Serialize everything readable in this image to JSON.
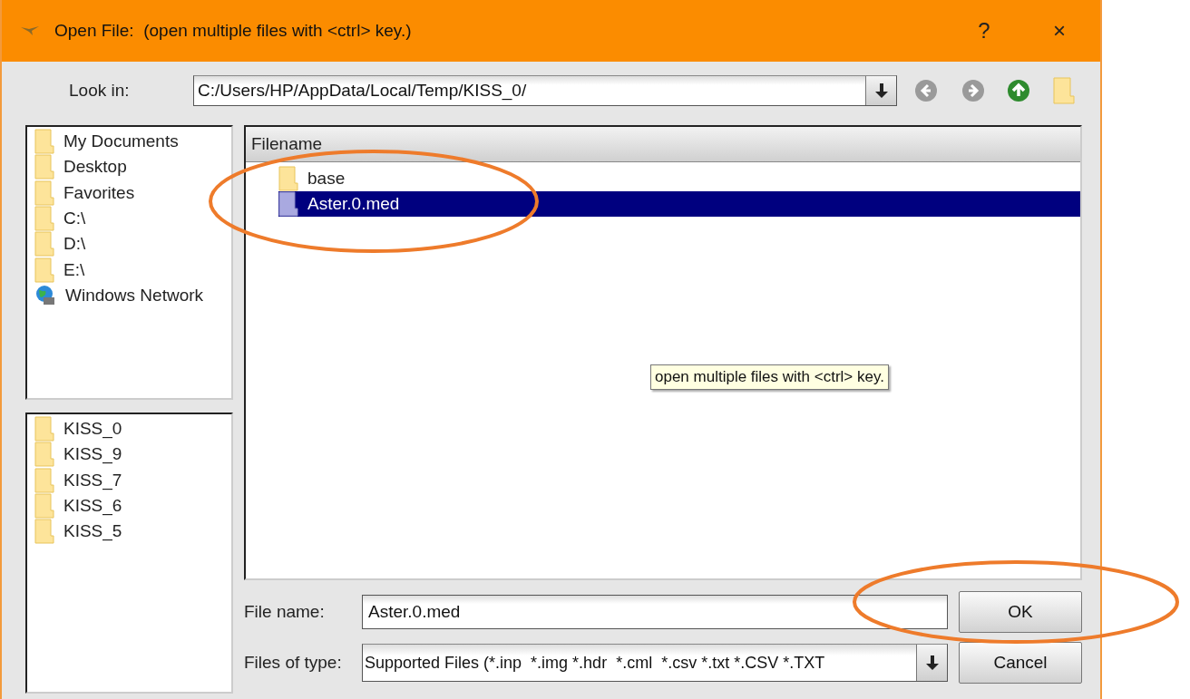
{
  "window": {
    "title": "Open File:  (open multiple files with <ctrl> key.)",
    "help": "?",
    "close": "×"
  },
  "look_in": {
    "label": "Look in:",
    "value": "C:/Users/HP/AppData/Local/Temp/KISS_0/"
  },
  "places": [
    {
      "name": "My Documents",
      "kind": "folder"
    },
    {
      "name": "Desktop",
      "kind": "folder"
    },
    {
      "name": "Favorites",
      "kind": "folder"
    },
    {
      "name": "C:\\",
      "kind": "folder"
    },
    {
      "name": "D:\\",
      "kind": "folder"
    },
    {
      "name": "E:\\",
      "kind": "folder"
    },
    {
      "name": "Windows Network",
      "kind": "network"
    }
  ],
  "recent": [
    "KISS_0",
    "KISS_9",
    "KISS_7",
    "KISS_6",
    "KISS_5"
  ],
  "table": {
    "column": "Filename",
    "rows": [
      {
        "name": "base",
        "kind": "folder",
        "selected": false
      },
      {
        "name": "Aster.0.med",
        "kind": "file",
        "selected": true
      }
    ]
  },
  "tooltip": "open multiple files with <ctrl> key.",
  "file_name": {
    "label": "File name:",
    "value": "Aster.0.med"
  },
  "file_type": {
    "label": "Files of type:",
    "value": "Supported Files (*.inp  *.img *.hdr  *.cml  *.csv *.txt *.CSV *.TXT"
  },
  "buttons": [
    {
      "label": "OK"
    },
    {
      "label": "Cancel"
    }
  ]
}
